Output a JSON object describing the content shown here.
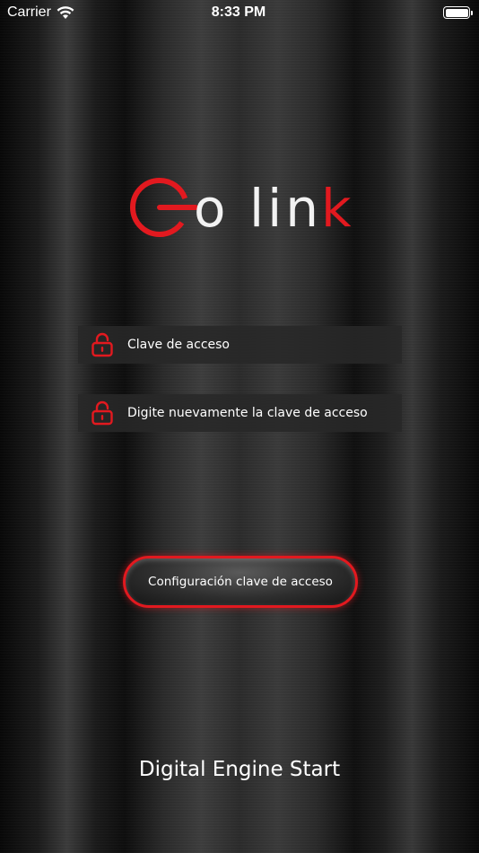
{
  "status_bar": {
    "carrier": "Carrier",
    "time": "8:33 PM"
  },
  "logo": {
    "text_first": "o ",
    "text_last": "lin",
    "text_k": "k",
    "accent_color": "#e2191f"
  },
  "form": {
    "password_placeholder": "Clave de acceso",
    "confirm_placeholder": "Digite nuevamente la clave de acceso"
  },
  "config_button_label": "Configuración clave de acceso",
  "footer": "Digital Engine Start",
  "icons": [
    "wifi-icon",
    "battery-icon",
    "lock-icon"
  ]
}
